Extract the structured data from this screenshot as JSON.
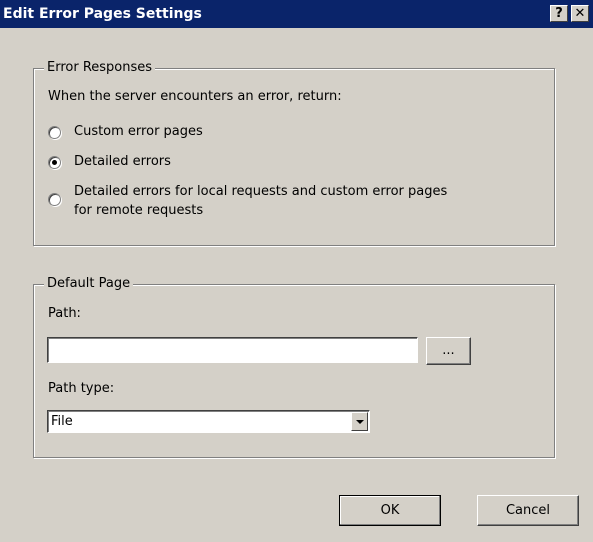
{
  "window": {
    "title": "Edit Error Pages Settings",
    "help_glyph": "?",
    "close_glyph": "✕"
  },
  "error_responses": {
    "legend": "Error Responses",
    "prompt": "When the server encounters an error, return:",
    "options": [
      {
        "label": "Custom error pages",
        "selected": false
      },
      {
        "label": "Detailed errors",
        "selected": true
      },
      {
        "label_line1": "Detailed errors for local requests and custom error pages",
        "label_line2": "for remote requests",
        "selected": false
      }
    ]
  },
  "default_page": {
    "legend": "Default Page",
    "path_label": "Path:",
    "path_value": "",
    "browse_label": "...",
    "path_type_label": "Path type:",
    "path_type_value": "File"
  },
  "buttons": {
    "ok": "OK",
    "cancel": "Cancel"
  },
  "icons": {
    "help": "help-icon",
    "close": "close-icon",
    "dropdown": "chevron-down-icon"
  }
}
